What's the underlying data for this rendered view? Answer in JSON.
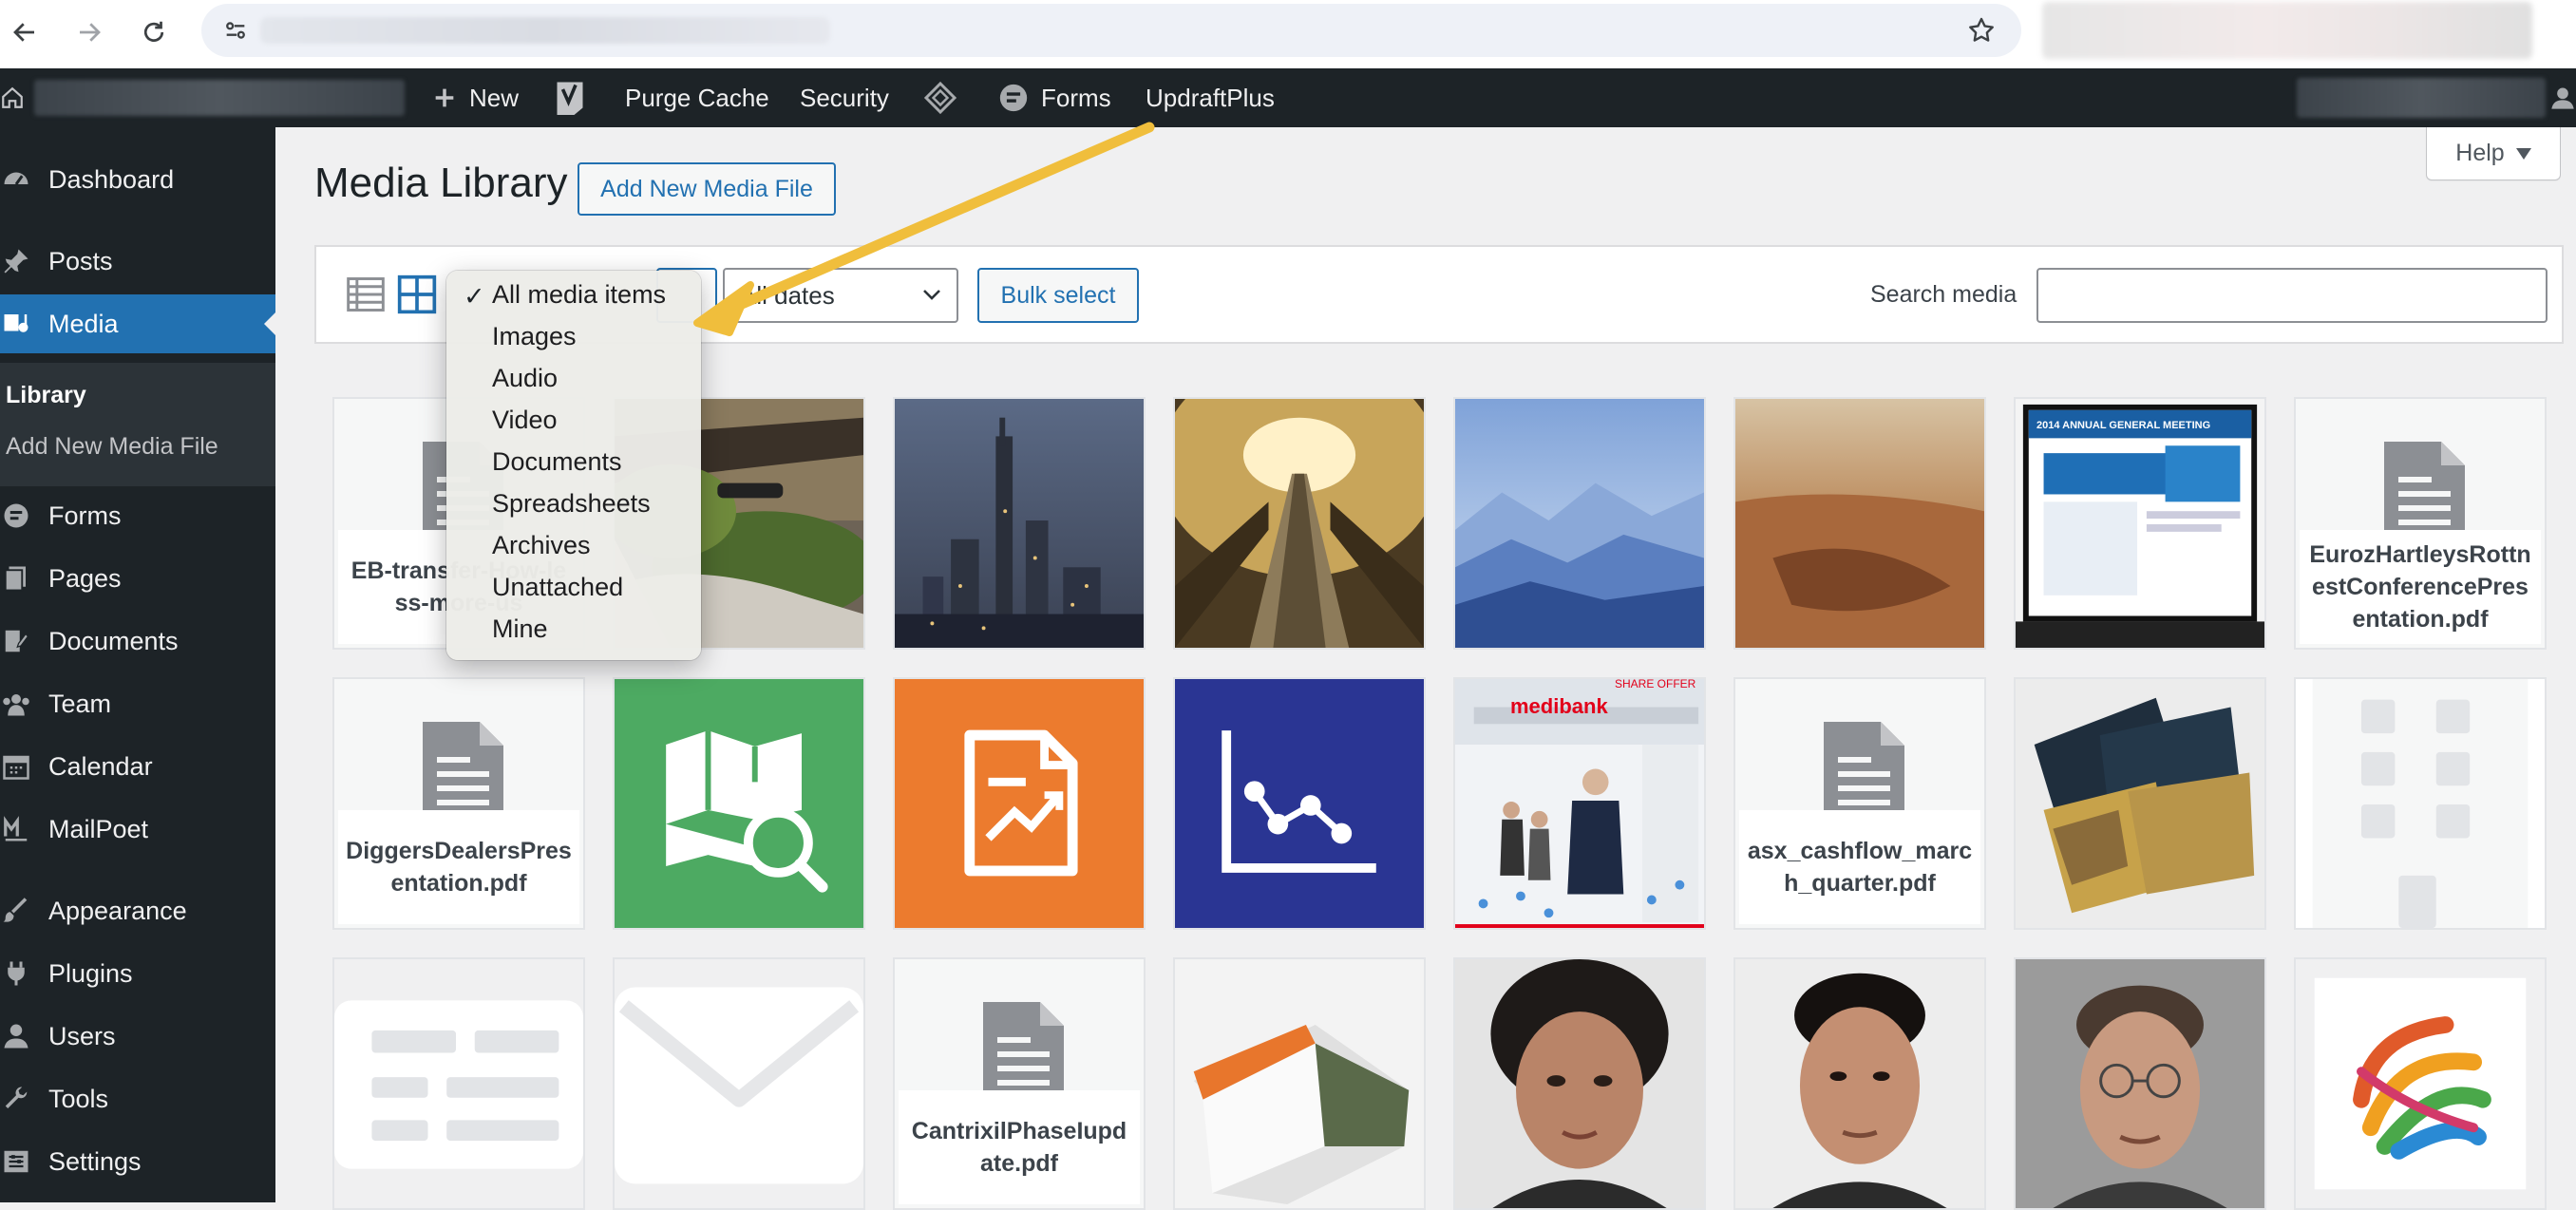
{
  "admin_bar": {
    "new_label": "New",
    "purge_cache": "Purge Cache",
    "security": "Security",
    "forms": "Forms",
    "updraft": "UpdraftPlus"
  },
  "sidebar": {
    "items": [
      {
        "label": "Dashboard",
        "icon": "dashboard-icon"
      },
      {
        "label": "Posts",
        "icon": "pin-icon"
      },
      {
        "label": "Media",
        "icon": "media-icon"
      },
      {
        "label": "Forms",
        "icon": "forms-icon"
      },
      {
        "label": "Pages",
        "icon": "pages-icon"
      },
      {
        "label": "Documents",
        "icon": "documents-icon"
      },
      {
        "label": "Team",
        "icon": "team-icon"
      },
      {
        "label": "Calendar",
        "icon": "calendar-icon"
      },
      {
        "label": "MailPoet",
        "icon": "mailpoet-icon"
      },
      {
        "label": "Appearance",
        "icon": "brush-icon"
      },
      {
        "label": "Plugins",
        "icon": "plug-icon"
      },
      {
        "label": "Users",
        "icon": "user-icon"
      },
      {
        "label": "Tools",
        "icon": "wrench-icon"
      },
      {
        "label": "Settings",
        "icon": "settings-icon"
      }
    ],
    "submenu": {
      "library": "Library",
      "add_new": "Add New Media File"
    }
  },
  "page": {
    "title": "Media Library",
    "add_new": "Add New Media File",
    "help": "Help"
  },
  "toolbar": {
    "date_filter": "All dates",
    "bulk_select": "Bulk select",
    "search_label": "Search media"
  },
  "type_menu": {
    "selected": "All media items",
    "options": [
      "All media items",
      "Images",
      "Audio",
      "Video",
      "Documents",
      "Spreadsheets",
      "Archives",
      "Unattached",
      "Mine"
    ]
  },
  "media_grid": {
    "doc_names": {
      "r1c1": "EB-transfer-How-less-more-us",
      "r1c8": "EurozHartleysRottnestConferencePresentation.pdf",
      "r2c1": "DiggersDealersPresentation.pdf",
      "r2c6": "asx_cashflow_march_quarter.pdf",
      "r3c3": "CantrixilPhaseIupdate.pdf"
    },
    "thumb_text": {
      "agm": "2014 ANNUAL GENERAL MEETING",
      "medibank": "medibank",
      "share_offer": "SHARE OFFER"
    }
  },
  "colors": {
    "admin_bar": "#1d2327",
    "accent": "#2271b1",
    "arrow": "#f0be3c",
    "green_tile": "#4daa62",
    "orange_tile": "#ec7b2e",
    "blue_tile": "#2a3593"
  }
}
